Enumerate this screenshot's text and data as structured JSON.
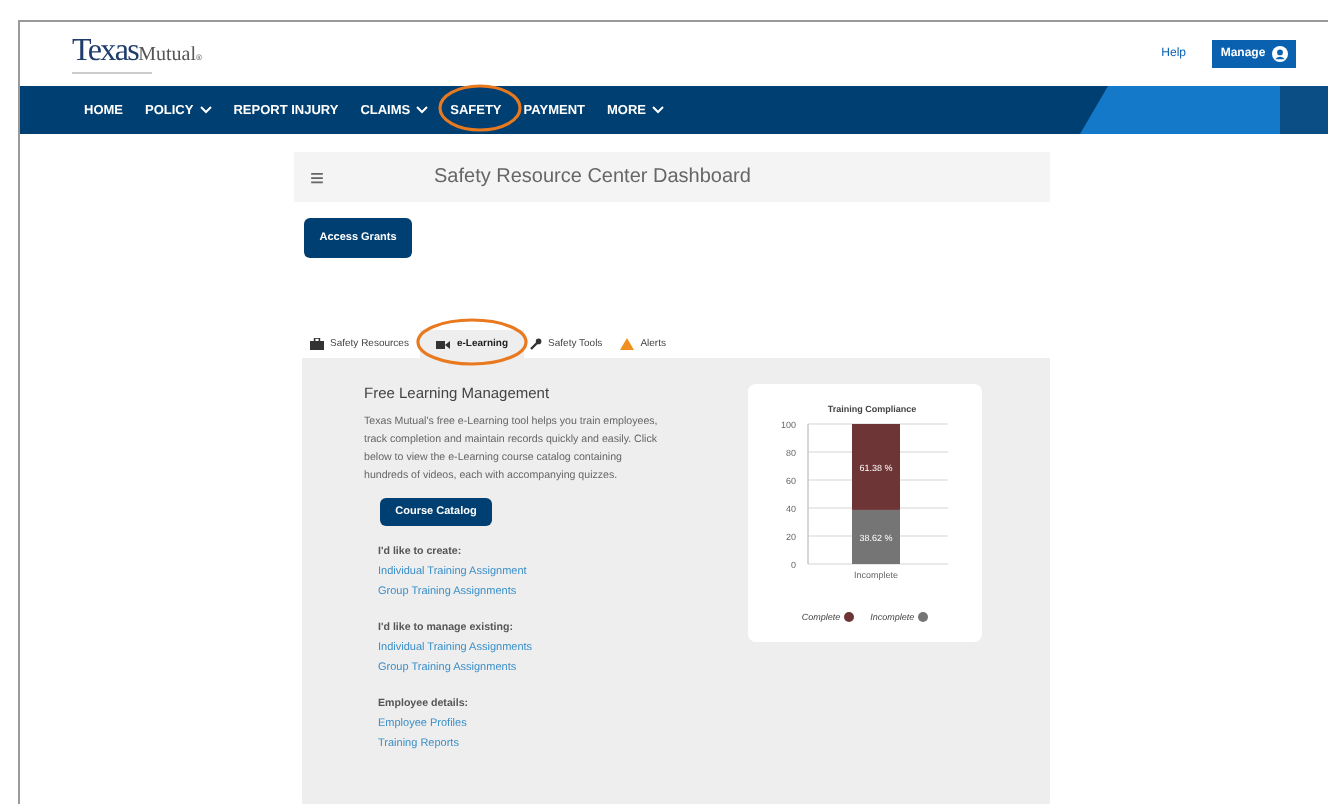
{
  "header": {
    "logo_main": "Texas",
    "logo_sub": "Mutual",
    "logo_mark": "®",
    "help": "Help",
    "manage_button": "Manage"
  },
  "nav": [
    {
      "label": "HOME",
      "caret": false
    },
    {
      "label": "POLICY",
      "caret": true
    },
    {
      "label": "REPORT INJURY",
      "caret": false
    },
    {
      "label": "CLAIMS",
      "caret": true
    },
    {
      "label": "SAFETY",
      "caret": false
    },
    {
      "label": "PAYMENT",
      "caret": false
    },
    {
      "label": "MORE",
      "caret": true
    }
  ],
  "dashboard": {
    "menu_glyph": "≡",
    "title": "Safety Resource Center Dashboard",
    "access_button": "Access Grants"
  },
  "tabs": [
    {
      "label": "Safety Resources",
      "selected": false
    },
    {
      "label": "e-Learning",
      "selected": true
    },
    {
      "label": "Safety Tools",
      "selected": false
    },
    {
      "label": "Alerts",
      "selected": false
    }
  ],
  "panel": {
    "heading": "Free Learning Management",
    "description": "Texas Mutual's free e-Learning tool helps you train employees, track completion and maintain records quickly and easily. Click below to view the e-Learning course catalog containing hundreds of videos, each with accompanying quizzes.",
    "catalog_button": "Course Catalog",
    "sections": [
      {
        "label": "I'd like to create:",
        "links": [
          "Individual Training Assignment",
          "Group Training Assignments"
        ]
      },
      {
        "label": "I'd like to manage existing:",
        "links": [
          "Individual Training Assignments",
          "Group Training Assignments"
        ]
      },
      {
        "label": "Employee details:",
        "links": [
          "Employee Profiles",
          "Training Reports"
        ]
      }
    ]
  },
  "chart_data": {
    "type": "bar",
    "title": "Training Compliance",
    "stacked": true,
    "grid": true,
    "categories": [
      "Incomplete"
    ],
    "ylim": [
      0,
      100
    ],
    "yticks": [
      0,
      20,
      40,
      60,
      80,
      100
    ],
    "series": [
      {
        "name": "Complete",
        "color": "#6e3537",
        "values": [
          61.38
        ],
        "value_labels": [
          "61.38 %"
        ]
      },
      {
        "name": "Incomplete",
        "color": "#757575",
        "values": [
          38.62
        ],
        "value_labels": [
          "38.62 %"
        ]
      }
    ]
  }
}
